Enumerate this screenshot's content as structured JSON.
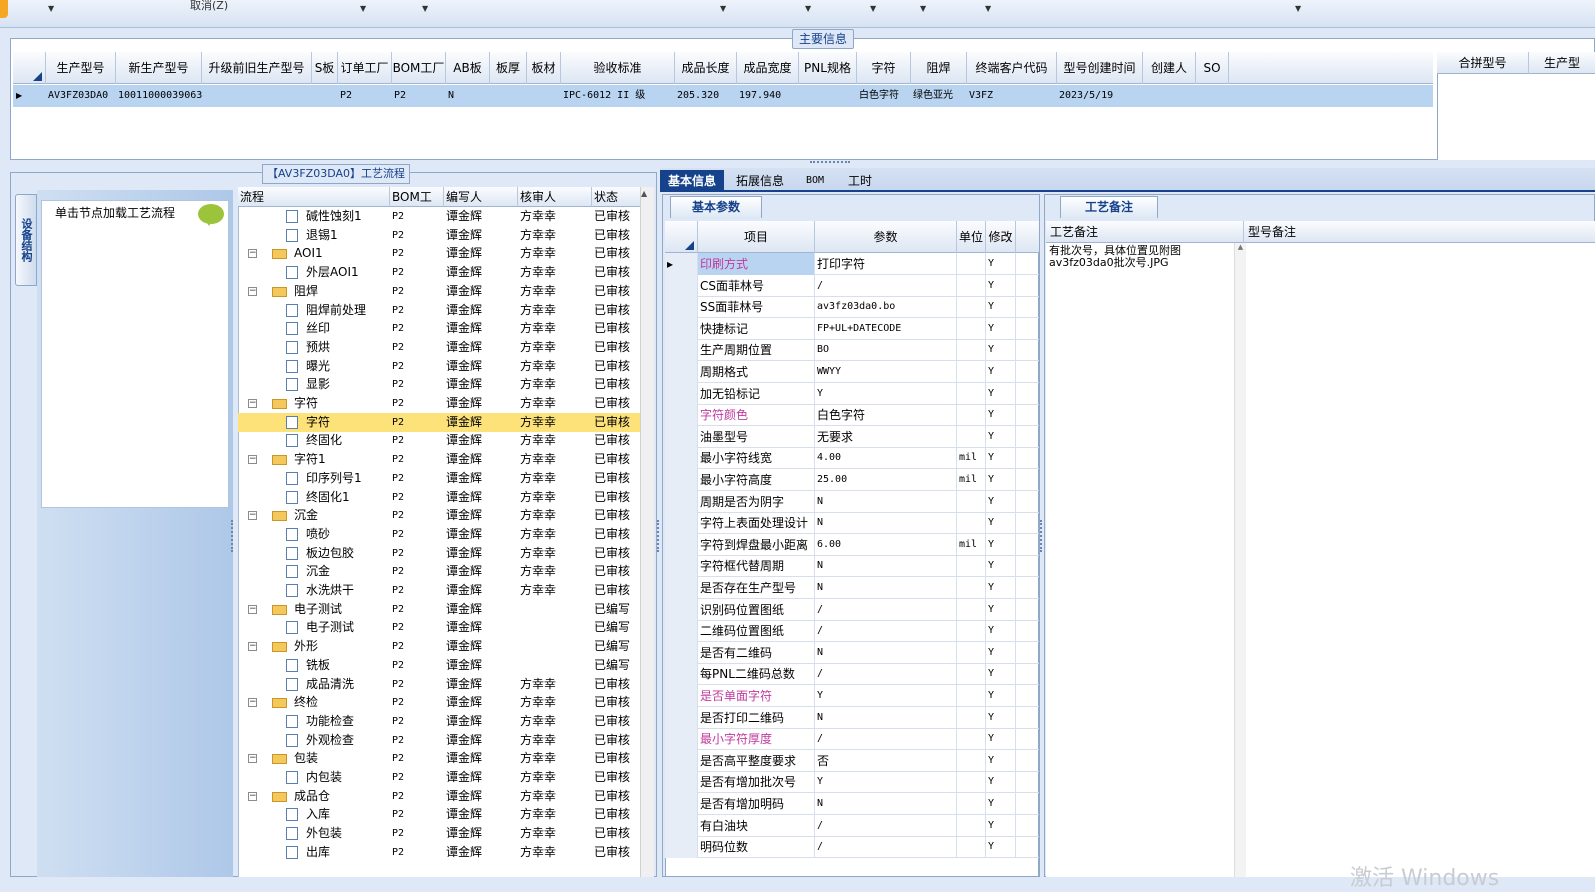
{
  "toolbar": {
    "cancel_label": "取消(Z)"
  },
  "main_info": {
    "title": "主要信息",
    "columns": [
      "生产型号",
      "新生产型号",
      "升级前旧生产型号",
      "S板",
      "订单工厂",
      "BOM工厂",
      "AB板",
      "板厚",
      "板材",
      "验收标准",
      "成品长度",
      "成品宽度",
      "PNL规格",
      "字符",
      "阻焊",
      "终端客户代码",
      "型号创建时间",
      "创建人",
      "SO"
    ],
    "row": [
      "AV3FZ03DA0",
      "10011000039063",
      "",
      "",
      "P2",
      "P2",
      "N",
      "",
      "",
      "IPC-6012 II 级",
      "205.320",
      "197.940",
      "",
      "白色字符",
      "绿色亚光",
      "V3FZ",
      "2023/5/19",
      "",
      ""
    ],
    "merge_columns": [
      "合拼型号",
      "生产型"
    ]
  },
  "process": {
    "title": "【AV3FZ03DA0】工艺流程",
    "side_tab": "设备结构",
    "load_button": "单击节点加载工艺流程",
    "columns": [
      "流程",
      "BOM工厂",
      "编写人",
      "核审人",
      "状态"
    ],
    "rows": [
      {
        "name": "碱性蚀刻1",
        "bom": "P2",
        "writer": "谭金辉",
        "reviewer": "方幸幸",
        "status": "已审核",
        "level": 2
      },
      {
        "name": "退锡1",
        "bom": "P2",
        "writer": "谭金辉",
        "reviewer": "方幸幸",
        "status": "已审核",
        "level": 2
      },
      {
        "name": "AOI1",
        "bom": "P2",
        "writer": "谭金辉",
        "reviewer": "方幸幸",
        "status": "已审核",
        "level": 1
      },
      {
        "name": "外层AOI1",
        "bom": "P2",
        "writer": "谭金辉",
        "reviewer": "方幸幸",
        "status": "已审核",
        "level": 2
      },
      {
        "name": "阻焊",
        "bom": "P2",
        "writer": "谭金辉",
        "reviewer": "方幸幸",
        "status": "已审核",
        "level": 1
      },
      {
        "name": "阻焊前处理",
        "bom": "P2",
        "writer": "谭金辉",
        "reviewer": "方幸幸",
        "status": "已审核",
        "level": 2
      },
      {
        "name": "丝印",
        "bom": "P2",
        "writer": "谭金辉",
        "reviewer": "方幸幸",
        "status": "已审核",
        "level": 2
      },
      {
        "name": "预烘",
        "bom": "P2",
        "writer": "谭金辉",
        "reviewer": "方幸幸",
        "status": "已审核",
        "level": 2
      },
      {
        "name": "曝光",
        "bom": "P2",
        "writer": "谭金辉",
        "reviewer": "方幸幸",
        "status": "已审核",
        "level": 2
      },
      {
        "name": "显影",
        "bom": "P2",
        "writer": "谭金辉",
        "reviewer": "方幸幸",
        "status": "已审核",
        "level": 2
      },
      {
        "name": "字符",
        "bom": "P2",
        "writer": "谭金辉",
        "reviewer": "方幸幸",
        "status": "已审核",
        "level": 1
      },
      {
        "name": "字符",
        "bom": "P2",
        "writer": "谭金辉",
        "reviewer": "方幸幸",
        "status": "已审核",
        "level": 2,
        "selected": true
      },
      {
        "name": "终固化",
        "bom": "P2",
        "writer": "谭金辉",
        "reviewer": "方幸幸",
        "status": "已审核",
        "level": 2
      },
      {
        "name": "字符1",
        "bom": "P2",
        "writer": "谭金辉",
        "reviewer": "方幸幸",
        "status": "已审核",
        "level": 1
      },
      {
        "name": "印序列号1",
        "bom": "P2",
        "writer": "谭金辉",
        "reviewer": "方幸幸",
        "status": "已审核",
        "level": 2
      },
      {
        "name": "终固化1",
        "bom": "P2",
        "writer": "谭金辉",
        "reviewer": "方幸幸",
        "status": "已审核",
        "level": 2
      },
      {
        "name": "沉金",
        "bom": "P2",
        "writer": "谭金辉",
        "reviewer": "方幸幸",
        "status": "已审核",
        "level": 1
      },
      {
        "name": "喷砂",
        "bom": "P2",
        "writer": "谭金辉",
        "reviewer": "方幸幸",
        "status": "已审核",
        "level": 2
      },
      {
        "name": "板边包胶",
        "bom": "P2",
        "writer": "谭金辉",
        "reviewer": "方幸幸",
        "status": "已审核",
        "level": 2
      },
      {
        "name": "沉金",
        "bom": "P2",
        "writer": "谭金辉",
        "reviewer": "方幸幸",
        "status": "已审核",
        "level": 2
      },
      {
        "name": "水洗烘干",
        "bom": "P2",
        "writer": "谭金辉",
        "reviewer": "方幸幸",
        "status": "已审核",
        "level": 2
      },
      {
        "name": "电子测试",
        "bom": "P2",
        "writer": "谭金辉",
        "reviewer": "",
        "status": "已编写",
        "level": 1
      },
      {
        "name": "电子测试",
        "bom": "P2",
        "writer": "谭金辉",
        "reviewer": "",
        "status": "已编写",
        "level": 2
      },
      {
        "name": "外形",
        "bom": "P2",
        "writer": "谭金辉",
        "reviewer": "",
        "status": "已编写",
        "level": 1
      },
      {
        "name": "铣板",
        "bom": "P2",
        "writer": "谭金辉",
        "reviewer": "",
        "status": "已编写",
        "level": 2
      },
      {
        "name": "成品清洗",
        "bom": "P2",
        "writer": "谭金辉",
        "reviewer": "方幸幸",
        "status": "已审核",
        "level": 2
      },
      {
        "name": "终检",
        "bom": "P2",
        "writer": "谭金辉",
        "reviewer": "方幸幸",
        "status": "已审核",
        "level": 1
      },
      {
        "name": "功能检查",
        "bom": "P2",
        "writer": "谭金辉",
        "reviewer": "方幸幸",
        "status": "已审核",
        "level": 2
      },
      {
        "name": "外观检查",
        "bom": "P2",
        "writer": "谭金辉",
        "reviewer": "方幸幸",
        "status": "已审核",
        "level": 2
      },
      {
        "name": "包装",
        "bom": "P2",
        "writer": "谭金辉",
        "reviewer": "方幸幸",
        "status": "已审核",
        "level": 1
      },
      {
        "name": "内包装",
        "bom": "P2",
        "writer": "谭金辉",
        "reviewer": "方幸幸",
        "status": "已审核",
        "level": 2
      },
      {
        "name": "成品仓",
        "bom": "P2",
        "writer": "谭金辉",
        "reviewer": "方幸幸",
        "status": "已审核",
        "level": 1
      },
      {
        "name": "入库",
        "bom": "P2",
        "writer": "谭金辉",
        "reviewer": "方幸幸",
        "status": "已审核",
        "level": 2
      },
      {
        "name": "外包装",
        "bom": "P2",
        "writer": "谭金辉",
        "reviewer": "方幸幸",
        "status": "已审核",
        "level": 2
      },
      {
        "name": "出库",
        "bom": "P2",
        "writer": "谭金辉",
        "reviewer": "方幸幸",
        "status": "已审核",
        "level": 2
      }
    ]
  },
  "tabs": [
    "基本信息",
    "拓展信息",
    "BOM",
    "工时"
  ],
  "basic": {
    "title": "基本参数",
    "columns": [
      "项目",
      "参数",
      "单位",
      "修改"
    ],
    "rows": [
      {
        "item": "印刷方式",
        "param": "打印字符",
        "unit": "",
        "mod": "Y",
        "highlight": true
      },
      {
        "item": "CS面菲林号",
        "param": "/",
        "unit": "",
        "mod": "Y"
      },
      {
        "item": "SS面菲林号",
        "param": "av3fz03da0.bo",
        "unit": "",
        "mod": "Y"
      },
      {
        "item": "快捷标记",
        "param": "FP+UL+DATECODE",
        "unit": "",
        "mod": "Y"
      },
      {
        "item": "生产周期位置",
        "param": "BO",
        "unit": "",
        "mod": "Y"
      },
      {
        "item": "周期格式",
        "param": "WWYY",
        "unit": "",
        "mod": "Y"
      },
      {
        "item": "加无铅标记",
        "param": "Y",
        "unit": "",
        "mod": "Y"
      },
      {
        "item": "字符颜色",
        "param": "白色字符",
        "unit": "",
        "mod": "Y",
        "highlight": true
      },
      {
        "item": "油墨型号",
        "param": "无要求",
        "unit": "",
        "mod": "Y"
      },
      {
        "item": "最小字符线宽",
        "param": "4.00",
        "unit": "mil",
        "mod": "Y"
      },
      {
        "item": "最小字符高度",
        "param": "25.00",
        "unit": "mil",
        "mod": "Y"
      },
      {
        "item": "周期是否为阴字",
        "param": "N",
        "unit": "",
        "mod": "Y"
      },
      {
        "item": "字符上表面处理设计",
        "param": "N",
        "unit": "",
        "mod": "Y"
      },
      {
        "item": "字符到焊盘最小距离",
        "param": "6.00",
        "unit": "mil",
        "mod": "Y"
      },
      {
        "item": "字符框代替周期",
        "param": "N",
        "unit": "",
        "mod": "Y"
      },
      {
        "item": "是否存在生产型号",
        "param": "N",
        "unit": "",
        "mod": "Y"
      },
      {
        "item": "识别码位置图纸",
        "param": "/",
        "unit": "",
        "mod": "Y"
      },
      {
        "item": "二维码位置图纸",
        "param": "/",
        "unit": "",
        "mod": "Y"
      },
      {
        "item": "是否有二维码",
        "param": "N",
        "unit": "",
        "mod": "Y"
      },
      {
        "item": "每PNL二维码总数",
        "param": "/",
        "unit": "",
        "mod": "Y"
      },
      {
        "item": "是否单面字符",
        "param": "Y",
        "unit": "",
        "mod": "Y",
        "highlight": true
      },
      {
        "item": "是否打印二维码",
        "param": "N",
        "unit": "",
        "mod": "Y"
      },
      {
        "item": "最小字符厚度",
        "param": "/",
        "unit": "",
        "mod": "Y",
        "highlight": true
      },
      {
        "item": "是否高平整度要求",
        "param": "否",
        "unit": "",
        "mod": "Y"
      },
      {
        "item": "是否有增加批次号",
        "param": "Y",
        "unit": "",
        "mod": "Y"
      },
      {
        "item": "是否有增加明码",
        "param": "N",
        "unit": "",
        "mod": "Y"
      },
      {
        "item": "有白油块",
        "param": "/",
        "unit": "",
        "mod": "Y"
      },
      {
        "item": "明码位数",
        "param": "/",
        "unit": "",
        "mod": "Y"
      }
    ]
  },
  "notes": {
    "title": "工艺备注",
    "columns": [
      "工艺备注",
      "型号备注"
    ],
    "text": "有批次号，具体位置见附图\nav3fz03da0批次号.JPG"
  },
  "watermark": "激活 Windows",
  "colors": {
    "accent": "#15428b",
    "selected_row": "#fde27a",
    "highlight_text": "#c0399e"
  }
}
